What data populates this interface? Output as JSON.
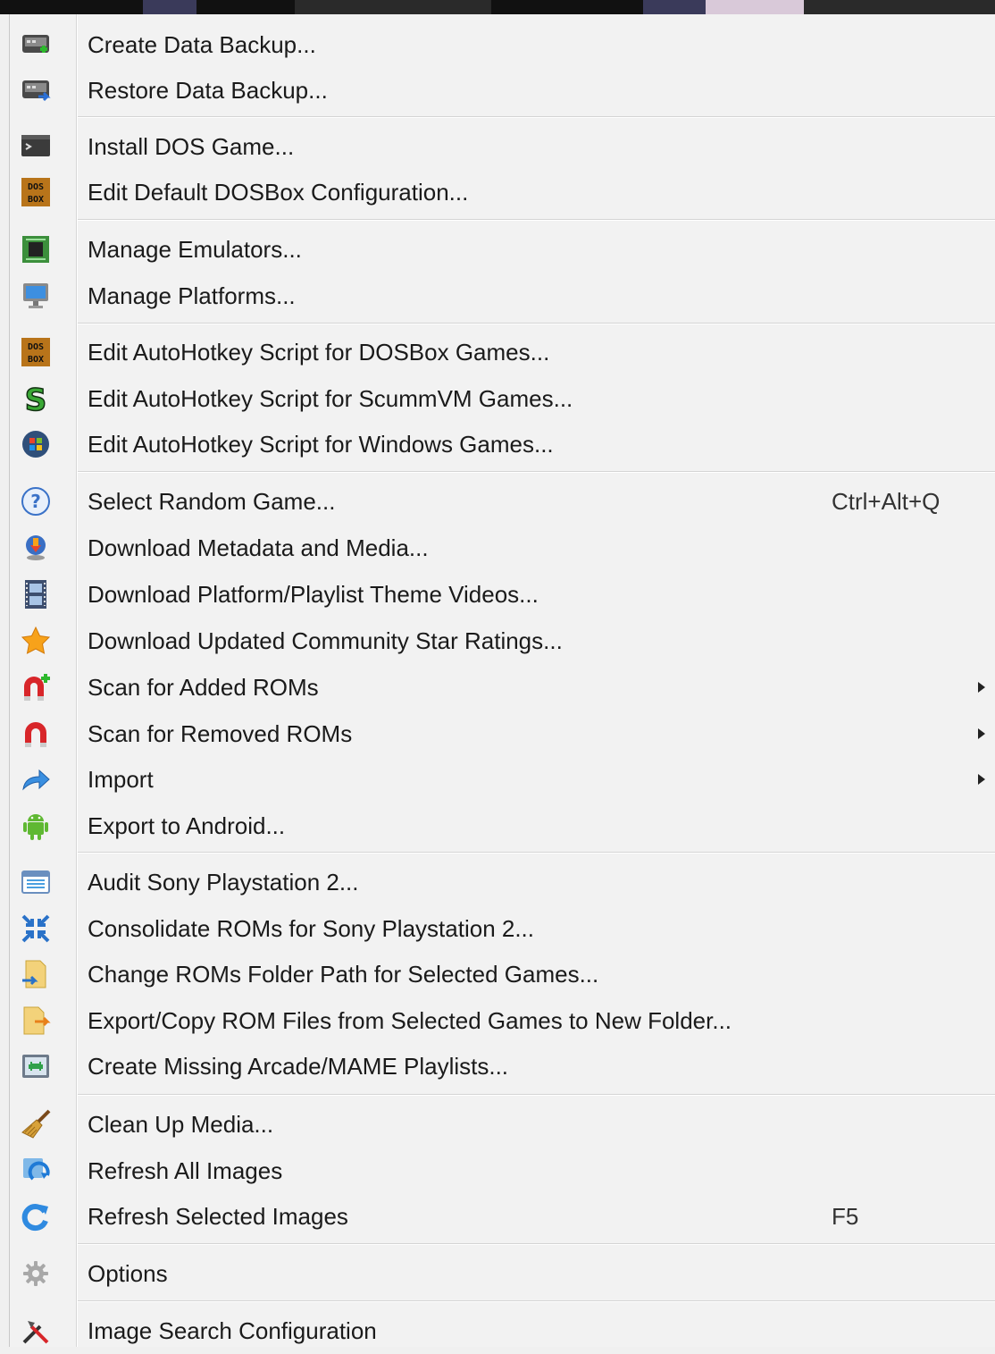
{
  "menu": {
    "items": [
      {
        "id": "create-data-backup",
        "label": "Create Data Backup...",
        "icon": "backup-create-icon"
      },
      {
        "id": "restore-data-backup",
        "label": "Restore Data Backup...",
        "icon": "backup-restore-icon"
      },
      {
        "id": "install-dos-game",
        "label": "Install DOS Game...",
        "icon": "terminal-icon"
      },
      {
        "id": "edit-default-dosbox-config",
        "label": "Edit Default DOSBox Configuration...",
        "icon": "dosbox-icon"
      },
      {
        "id": "manage-emulators",
        "label": "Manage Emulators...",
        "icon": "chip-icon"
      },
      {
        "id": "manage-platforms",
        "label": "Manage Platforms...",
        "icon": "monitor-icon"
      },
      {
        "id": "edit-ahk-dosbox",
        "label": "Edit AutoHotkey Script for DOSBox Games...",
        "icon": "dosbox-icon"
      },
      {
        "id": "edit-ahk-scummvm",
        "label": "Edit AutoHotkey Script for ScummVM Games...",
        "icon": "scummvm-icon"
      },
      {
        "id": "edit-ahk-windows",
        "label": "Edit AutoHotkey Script for Windows Games...",
        "icon": "windows-orb-icon"
      },
      {
        "id": "select-random-game",
        "label": "Select Random Game...",
        "shortcut": "Ctrl+Alt+Q",
        "icon": "question-icon"
      },
      {
        "id": "download-metadata-media",
        "label": "Download Metadata and Media...",
        "icon": "download-icon"
      },
      {
        "id": "download-theme-videos",
        "label": "Download Platform/Playlist Theme Videos...",
        "icon": "film-icon"
      },
      {
        "id": "download-star-ratings",
        "label": "Download Updated Community Star Ratings...",
        "icon": "star-icon"
      },
      {
        "id": "scan-added-roms",
        "label": "Scan for Added ROMs",
        "submenu": true,
        "icon": "magnet-add-icon"
      },
      {
        "id": "scan-removed-roms",
        "label": "Scan for Removed ROMs",
        "submenu": true,
        "icon": "magnet-icon"
      },
      {
        "id": "import",
        "label": "Import",
        "submenu": true,
        "icon": "import-arrow-icon"
      },
      {
        "id": "export-android",
        "label": "Export to Android...",
        "icon": "android-icon"
      },
      {
        "id": "audit-ps2",
        "label": "Audit Sony Playstation 2...",
        "icon": "calendar-icon"
      },
      {
        "id": "consolidate-roms-ps2",
        "label": "Consolidate ROMs for Sony Playstation 2...",
        "icon": "consolidate-arrows-icon"
      },
      {
        "id": "change-roms-folder-path",
        "label": "Change ROMs Folder Path for Selected Games...",
        "icon": "folder-path-icon"
      },
      {
        "id": "export-copy-rom-files",
        "label": "Export/Copy ROM Files from Selected Games to New Folder...",
        "icon": "folder-export-icon"
      },
      {
        "id": "create-mame-playlists",
        "label": "Create Missing Arcade/MAME Playlists...",
        "icon": "space-invader-icon"
      },
      {
        "id": "clean-up-media",
        "label": "Clean Up Media...",
        "icon": "broom-icon"
      },
      {
        "id": "refresh-all-images",
        "label": "Refresh All Images",
        "icon": "refresh-all-icon"
      },
      {
        "id": "refresh-selected-images",
        "label": "Refresh Selected Images",
        "shortcut": "F5",
        "icon": "refresh-icon"
      },
      {
        "id": "options",
        "label": "Options",
        "icon": "gear-icon"
      },
      {
        "id": "image-search-config",
        "label": "Image Search Configuration",
        "icon": "tools-icon"
      }
    ]
  }
}
